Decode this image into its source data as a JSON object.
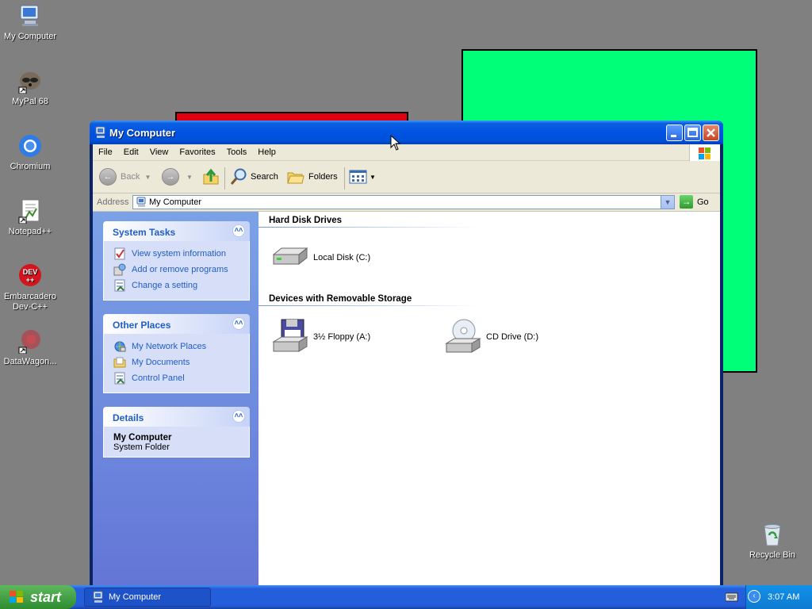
{
  "desktop": {
    "icons": [
      {
        "label": "My Computer",
        "icon": "my-computer-icon"
      },
      {
        "label": "MyPal 68",
        "icon": "mypal-icon"
      },
      {
        "label": "Chromium",
        "icon": "chromium-icon"
      },
      {
        "label": "Notepad++",
        "icon": "notepadpp-icon"
      },
      {
        "label": "Embarcadero Dev-C++",
        "line1": "Embarcadero",
        "line2": "Dev-C++",
        "icon": "devcpp-icon",
        "badge": "DEV\n++"
      },
      {
        "label": "DataWagon...",
        "icon": "datawagon-icon"
      },
      {
        "label": "Recycle Bin",
        "icon": "recycle-bin-icon"
      }
    ]
  },
  "window": {
    "title": "My Computer",
    "menu": [
      "File",
      "Edit",
      "View",
      "Favorites",
      "Tools",
      "Help"
    ],
    "toolbar": {
      "back": "Back",
      "search": "Search",
      "folders": "Folders"
    },
    "address": {
      "label": "Address",
      "value": "My Computer",
      "go": "Go"
    },
    "left_pane": {
      "system_tasks": {
        "title": "System Tasks",
        "items": [
          "View system information",
          "Add or remove programs",
          "Change a setting"
        ]
      },
      "other_places": {
        "title": "Other Places",
        "items": [
          "My Network Places",
          "My Documents",
          "Control Panel"
        ]
      },
      "details": {
        "title": "Details",
        "name": "My Computer",
        "type": "System Folder"
      }
    },
    "groups": {
      "hard_disks": {
        "title": "Hard Disk Drives",
        "items": [
          "Local Disk (C:)"
        ]
      },
      "removable": {
        "title": "Devices with Removable Storage",
        "items": [
          "3½ Floppy (A:)",
          "CD Drive (D:)"
        ]
      }
    }
  },
  "taskbar": {
    "start": "start",
    "task_item": "My Computer",
    "clock": "3:07 AM"
  },
  "colors": {
    "titlebar": "#0054e3",
    "taskbar": "#245edb",
    "start_green": "#3c9a3c",
    "background_red": "#e00010",
    "background_green": "#00ff78",
    "link_blue": "#215dc6"
  }
}
